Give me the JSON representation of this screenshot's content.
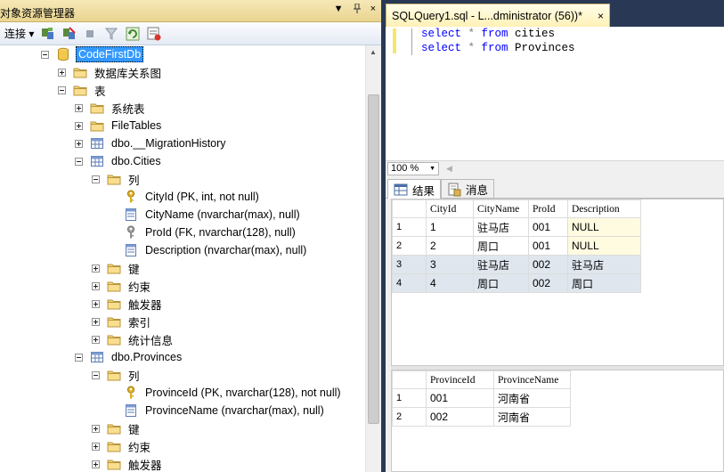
{
  "object_explorer": {
    "title": "对象资源管理器",
    "title_buttons": [
      "▼",
      "ᵍ",
      "×"
    ],
    "toolbar": {
      "connect_label": "连接 ▾"
    },
    "tree": [
      {
        "label": "CodeFirstDb",
        "icon": "database-icon",
        "expander": "minus",
        "selected": true
      },
      {
        "label": "数据库关系图",
        "icon": "folder-icon",
        "expander": "plus"
      },
      {
        "label": "表",
        "icon": "folder-icon",
        "expander": "minus"
      },
      {
        "label": "系统表",
        "icon": "folder-icon",
        "expander": "plus"
      },
      {
        "label": "FileTables",
        "icon": "folder-icon",
        "expander": "plus"
      },
      {
        "label": "dbo.__MigrationHistory",
        "icon": "table-icon",
        "expander": "plus"
      },
      {
        "label": "dbo.Cities",
        "icon": "table-icon",
        "expander": "minus"
      },
      {
        "label": "列",
        "icon": "folder-icon",
        "expander": "minus"
      },
      {
        "label": "CityId (PK, int, not null)",
        "icon": "key-icon",
        "expander": "none"
      },
      {
        "label": "CityName (nvarchar(max), null)",
        "icon": "column-icon",
        "expander": "none"
      },
      {
        "label": "ProId (FK, nvarchar(128), null)",
        "icon": "foreign-key-icon",
        "expander": "none"
      },
      {
        "label": "Description (nvarchar(max), null)",
        "icon": "column-icon",
        "expander": "none"
      },
      {
        "label": "键",
        "icon": "folder-icon",
        "expander": "plus"
      },
      {
        "label": "约束",
        "icon": "folder-icon",
        "expander": "plus"
      },
      {
        "label": "触发器",
        "icon": "folder-icon",
        "expander": "plus"
      },
      {
        "label": "索引",
        "icon": "folder-icon",
        "expander": "plus"
      },
      {
        "label": "统计信息",
        "icon": "folder-icon",
        "expander": "plus"
      },
      {
        "label": "dbo.Provinces",
        "icon": "table-icon",
        "expander": "minus"
      },
      {
        "label": "列",
        "icon": "folder-icon",
        "expander": "minus"
      },
      {
        "label": "ProvinceId (PK, nvarchar(128), not null)",
        "icon": "key-icon",
        "expander": "none"
      },
      {
        "label": "ProvinceName (nvarchar(max), null)",
        "icon": "column-icon",
        "expander": "none"
      },
      {
        "label": "键",
        "icon": "folder-icon",
        "expander": "plus"
      },
      {
        "label": "约束",
        "icon": "folder-icon",
        "expander": "plus"
      },
      {
        "label": "触发器",
        "icon": "folder-icon",
        "expander": "plus"
      }
    ]
  },
  "query_window": {
    "tab_title": "SQLQuery1.sql - L...dministrator (56))*",
    "tab_close": "×",
    "code_lines": [
      {
        "kw1": "select",
        "op": " * ",
        "kw2": "from",
        "ident": " cities"
      },
      {
        "kw1": "select",
        "op": " * ",
        "kw2": "from",
        "ident": " Provinces"
      }
    ],
    "zoom": "100 %",
    "result_tabs": {
      "results": "结果",
      "messages": "消息"
    },
    "grid1": {
      "columns": [
        "CityId",
        "CityName",
        "ProId",
        "Description"
      ],
      "rows": [
        {
          "n": "1",
          "cells": [
            "1",
            "驻马店",
            "001",
            "NULL"
          ]
        },
        {
          "n": "2",
          "cells": [
            "2",
            "周口",
            "001",
            "NULL"
          ]
        },
        {
          "n": "3",
          "cells": [
            "3",
            "驻马店",
            "002",
            "驻马店"
          ]
        },
        {
          "n": "4",
          "cells": [
            "4",
            "周口",
            "002",
            "周口"
          ]
        }
      ]
    },
    "grid2": {
      "columns": [
        "ProvinceId",
        "ProvinceName"
      ],
      "rows": [
        {
          "n": "1",
          "cells": [
            "001",
            "河南省"
          ]
        },
        {
          "n": "2",
          "cells": [
            "002",
            "河南省"
          ]
        }
      ]
    }
  },
  "colors": {
    "chrome_dark": "#293955",
    "panel_title": "#f6e8b8",
    "selection": "#3399ff",
    "keyword": "#0000ff"
  }
}
